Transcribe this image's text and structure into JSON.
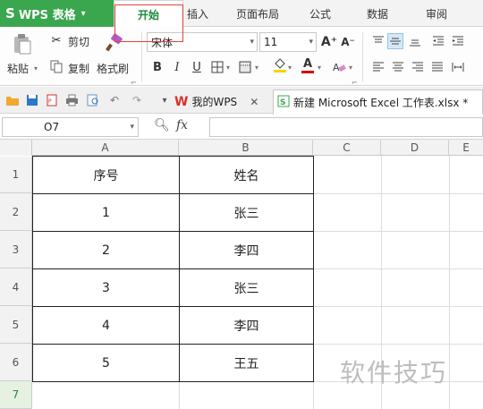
{
  "app": {
    "name": "WPS 表格",
    "logo": "S"
  },
  "menu": {
    "tabs": [
      {
        "label": "开始"
      },
      {
        "label": "插入"
      },
      {
        "label": "页面布局"
      },
      {
        "label": "公式"
      },
      {
        "label": "数据"
      },
      {
        "label": "审阅"
      }
    ]
  },
  "ribbon": {
    "paste_label": "粘贴",
    "cut_label": "剪切",
    "copy_label": "复制",
    "format_painter_label": "格式刷",
    "font_name": "宋体",
    "font_size": "11",
    "bold": "B",
    "italic": "I",
    "underline": "U",
    "grow_font": "A⁺",
    "shrink_font": "A⁻",
    "font_color_glyph": "A",
    "fill_color": "#f5d400",
    "font_color": "#d40000"
  },
  "quickbar": {
    "mywps_tab": "我的WPS",
    "file_tab": "新建 Microsoft Excel 工作表.xlsx *"
  },
  "formula_bar": {
    "cell_ref": "O7",
    "fx": "fx",
    "value": ""
  },
  "grid": {
    "columns": [
      "A",
      "B",
      "C",
      "D",
      "E"
    ],
    "rows": [
      "1",
      "2",
      "3",
      "4",
      "5",
      "6",
      "7"
    ],
    "active_row": "7",
    "cells": [
      [
        "序号",
        "姓名"
      ],
      [
        "1",
        "张三"
      ],
      [
        "2",
        "李四"
      ],
      [
        "3",
        "张三"
      ],
      [
        "4",
        "李四"
      ],
      [
        "5",
        "王五"
      ]
    ]
  },
  "watermark": "软件技巧"
}
